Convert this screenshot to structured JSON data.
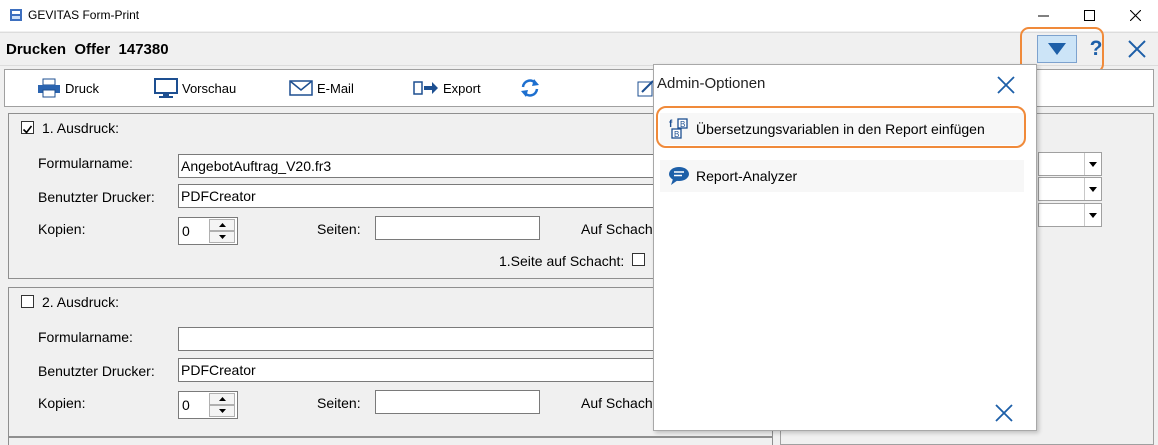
{
  "window": {
    "title": "GEVITAS Form-Print"
  },
  "header": {
    "title": "Drucken  Offer  147380",
    "help_label": "?"
  },
  "toolbar": {
    "print_label": "Druck",
    "print_key": "D",
    "preview_label": "Vorschau",
    "preview_key": "V",
    "email_label": "E-Mail",
    "export_label": "Export",
    "export_key": "x"
  },
  "print1": {
    "group_label": "1. Ausdruck:",
    "form_name_label": "Formularname:",
    "form_name_value": "AngebotAuftrag_V20.fr3",
    "printer_label": "Benutzter Drucker:",
    "printer_value": "PDFCreator",
    "copies_label": "Kopien:",
    "copies_value": "0",
    "pages_label": "Seiten:",
    "pages_value": "",
    "tray_label": "Auf Schach",
    "first_page_label": "1.Seite auf Schacht:",
    "checked": true
  },
  "print2": {
    "group_label": "2. Ausdruck:",
    "form_name_label": "Formularname:",
    "form_name_value": "",
    "printer_label": "Benutzter Drucker:",
    "printer_value": "PDFCreator",
    "copies_label": "Kopien:",
    "copies_value": "0",
    "pages_label": "Seiten:",
    "pages_value": "",
    "tray_label": "Auf Schach",
    "checked": false
  },
  "popup": {
    "title": "Admin-Optionen",
    "items": [
      {
        "label": "Übersetzungsvariablen in den Report einfügen",
        "icon": "translation-variables-icon"
      },
      {
        "label": "Report-Analyzer",
        "icon": "speech-bubble-icon"
      }
    ]
  },
  "colors": {
    "highlight": "#f08a3a",
    "accent": "#1d5fa8",
    "dropdown_bg": "#cce4f7"
  }
}
